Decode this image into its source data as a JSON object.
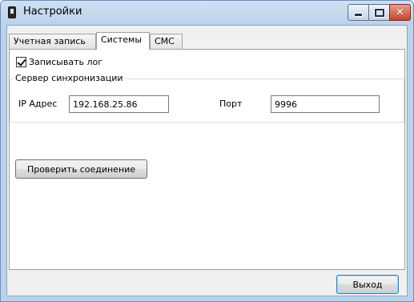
{
  "window": {
    "title": "Настройки"
  },
  "tabs": [
    {
      "label": "Учетная запись",
      "active": false
    },
    {
      "label": "Системы",
      "active": true
    },
    {
      "label": "СМС",
      "active": false
    }
  ],
  "log_checkbox": {
    "label": "Записывать лог",
    "checked": true
  },
  "sync_server": {
    "title": "Сервер синхронизации",
    "ip_label": "IP Адрес",
    "ip_value": "192.168.25.86",
    "port_label": "Порт",
    "port_value": "9996"
  },
  "test_button_label": "Проверить соединение",
  "exit_button_label": "Выход",
  "colors": {
    "close_button": "#c5432b",
    "titlebar": "#bcd2ea"
  }
}
